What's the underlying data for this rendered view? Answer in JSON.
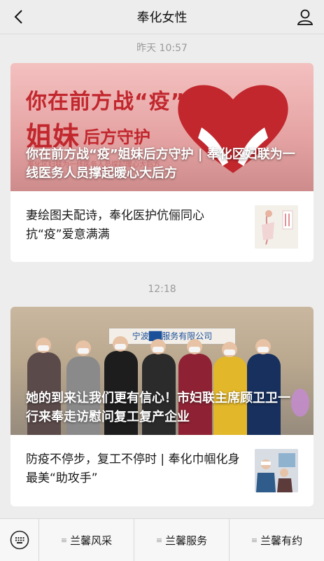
{
  "header": {
    "title": "奉化女性"
  },
  "messages": [
    {
      "time": "昨天 10:57",
      "hero": {
        "title": "你在前方战“疫”姐妹后方守护 | 奉化区妇联为一线医务人员撑起暖心大后方",
        "image_text": {
          "line1": "你在前方战“疫”",
          "line2a": "姐妹",
          "line2b": "后方守护",
          "small": "奉化区妇联为一线医务人员撑起暖心大后方"
        }
      },
      "sub": {
        "title": "妻绘图夫配诗，奉化医护伉俪同心抗“疫”爱意满满"
      }
    },
    {
      "time": "12:18",
      "hero": {
        "title": "她的到来让我们更有信心！市妇联主席顾卫卫一行来奉走访慰问复工复产企业",
        "sign": "宁波██服务有限公司"
      },
      "sub": {
        "title": "防疫不停步，复工不停时 | 奉化巾帼化身最美“助攻手”"
      }
    }
  ],
  "bottom_menu": {
    "items": [
      "兰馨风采",
      "兰馨服务",
      "兰馨有约"
    ]
  },
  "colors": {
    "accent_red": "#c1272d"
  }
}
